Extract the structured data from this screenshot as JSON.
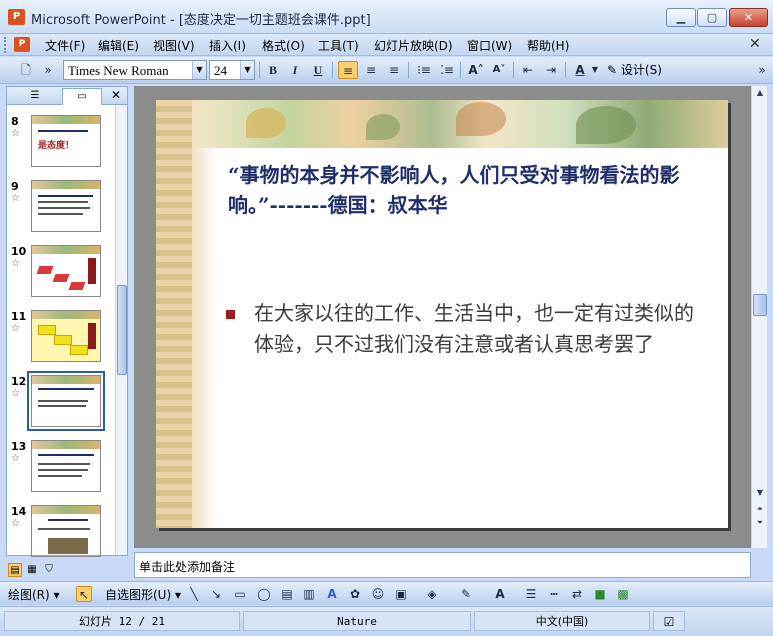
{
  "window": {
    "title": "Microsoft PowerPoint - [态度决定一切主题班会课件.ppt]",
    "app_icon": "powerpoint-icon"
  },
  "menu": {
    "items": [
      "文件(F)",
      "编辑(E)",
      "视图(V)",
      "插入(I)",
      "格式(O)",
      "工具(T)",
      "幻灯片放映(D)",
      "窗口(W)",
      "帮助(H)"
    ]
  },
  "toolbar": {
    "font_name": "Times New Roman",
    "font_size": "24",
    "bold": "B",
    "italic": "I",
    "underline": "U",
    "design_label": "设计(S)"
  },
  "thumbnails": [
    {
      "number": "8",
      "caption": "是态度！",
      "selected": false
    },
    {
      "number": "9",
      "caption": "",
      "selected": false
    },
    {
      "number": "10",
      "caption": "",
      "selected": false
    },
    {
      "number": "11",
      "caption": "",
      "selected": false
    },
    {
      "number": "12",
      "caption": "",
      "selected": true
    },
    {
      "number": "13",
      "caption": "",
      "selected": false
    },
    {
      "number": "14",
      "caption": "",
      "selected": false
    }
  ],
  "slide": {
    "title": "“事物的本身并不影响人，人们只受对事物看法的影响。”-------德国：叔本华",
    "bullet": "在大家以往的工作、生活当中，也一定有过类似的体验，只不过我们没有注意或者认真思考罢了"
  },
  "notes": {
    "placeholder": "单击此处添加备注"
  },
  "drawbar": {
    "draw_label": "绘图(R)",
    "autoshapes_label": "自选图形(U)"
  },
  "status": {
    "slide_position": "幻灯片 12 / 21",
    "design_name": "Nature",
    "language": "中文(中国)"
  },
  "colors": {
    "slide_title": "#1f2e6b",
    "bullet_mark": "#9b1d1d",
    "body_text": "#3b3b3b",
    "title_bar": "#c9ddf4"
  }
}
